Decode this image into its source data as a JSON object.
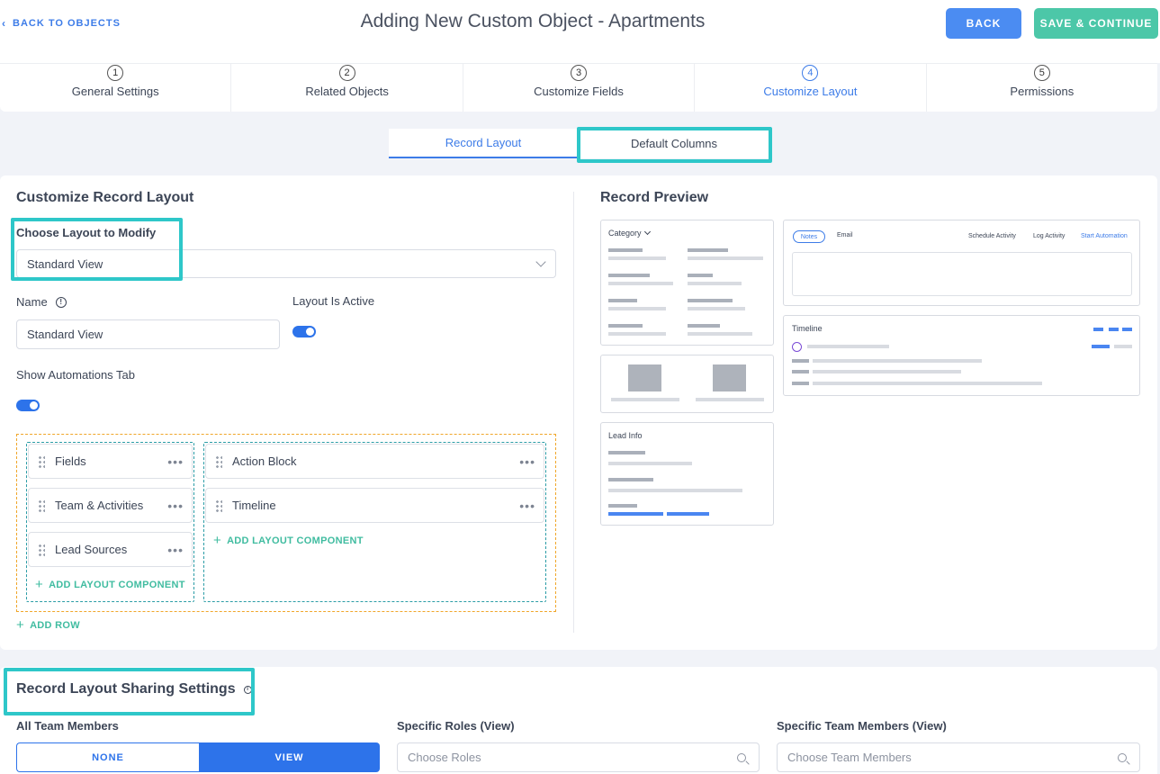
{
  "header": {
    "back_link": "BACK TO OBJECTS",
    "title": "Adding New Custom Object - Apartments",
    "back_button": "BACK",
    "save_button": "SAVE & CONTINUE"
  },
  "steps": [
    {
      "num": "1",
      "label": "General Settings"
    },
    {
      "num": "2",
      "label": "Related Objects"
    },
    {
      "num": "3",
      "label": "Customize Fields"
    },
    {
      "num": "4",
      "label": "Customize Layout",
      "active": true
    },
    {
      "num": "5",
      "label": "Permissions"
    }
  ],
  "subtabs": {
    "record_layout": "Record Layout",
    "default_columns": "Default Columns"
  },
  "customize": {
    "title": "Customize Record Layout",
    "choose_label": "Choose Layout to Modify",
    "choose_value": "Standard View",
    "name_label": "Name",
    "name_value": "Standard View",
    "active_label": "Layout Is Active",
    "automations_label": "Show Automations Tab",
    "left_components": [
      "Fields",
      "Team & Activities",
      "Lead Sources"
    ],
    "right_components": [
      "Action Block",
      "Timeline"
    ],
    "add_component": "ADD LAYOUT COMPONENT",
    "add_row": "ADD ROW"
  },
  "preview": {
    "title": "Record Preview",
    "category": "Category",
    "lead_info": "Lead Info",
    "timeline": "Timeline",
    "tabs": {
      "notes": "Notes",
      "email": "Email",
      "schedule": "Schedule Activity",
      "log": "Log Activity",
      "automation": "Start Automation"
    }
  },
  "sharing": {
    "title": "Record Layout Sharing Settings",
    "all_members_label": "All Team Members",
    "none": "NONE",
    "view": "VIEW",
    "roles_label": "Specific Roles (View)",
    "roles_placeholder": "Choose Roles",
    "members_label": "Specific Team Members (View)",
    "members_placeholder": "Choose Team Members"
  },
  "colors": {
    "accent": "#3d7ce8",
    "save": "#4cc7a8",
    "highlight": "#2ec7c9"
  }
}
